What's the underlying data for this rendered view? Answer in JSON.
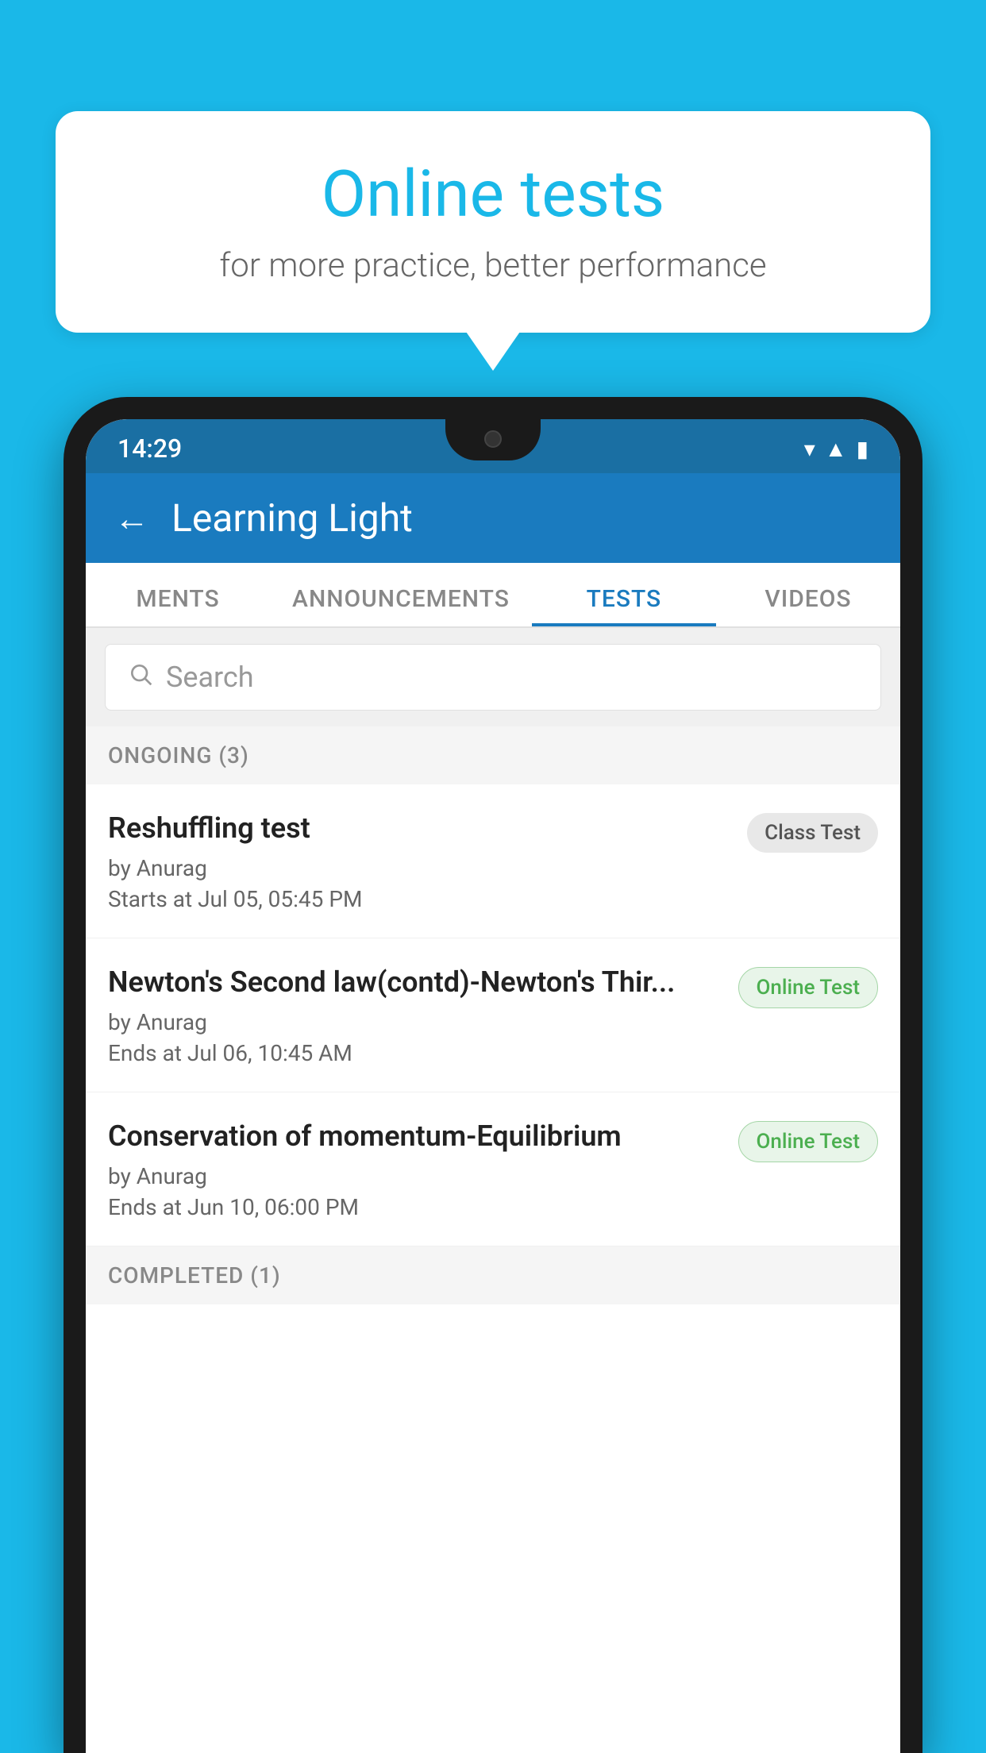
{
  "background": {
    "color": "#1ab8e8"
  },
  "bubble": {
    "title": "Online tests",
    "subtitle": "for more practice, better performance"
  },
  "phone": {
    "status_bar": {
      "time": "14:29",
      "icons": [
        "wifi",
        "signal",
        "battery"
      ]
    },
    "header": {
      "back_label": "←",
      "title": "Learning Light"
    },
    "tabs": [
      {
        "label": "MENTS",
        "active": false
      },
      {
        "label": "ANNOUNCEMENTS",
        "active": false
      },
      {
        "label": "TESTS",
        "active": true
      },
      {
        "label": "VIDEOS",
        "active": false
      }
    ],
    "search": {
      "placeholder": "Search"
    },
    "sections": [
      {
        "label": "ONGOING (3)",
        "items": [
          {
            "name": "Reshuffling test",
            "author": "by Anurag",
            "time_label": "Starts at",
            "time": "Jul 05, 05:45 PM",
            "badge": "Class Test",
            "badge_type": "class"
          },
          {
            "name": "Newton's Second law(contd)-Newton's Thir...",
            "author": "by Anurag",
            "time_label": "Ends at",
            "time": "Jul 06, 10:45 AM",
            "badge": "Online Test",
            "badge_type": "online"
          },
          {
            "name": "Conservation of momentum-Equilibrium",
            "author": "by Anurag",
            "time_label": "Ends at",
            "time": "Jun 10, 06:00 PM",
            "badge": "Online Test",
            "badge_type": "online"
          }
        ]
      }
    ],
    "completed_label": "COMPLETED (1)"
  }
}
